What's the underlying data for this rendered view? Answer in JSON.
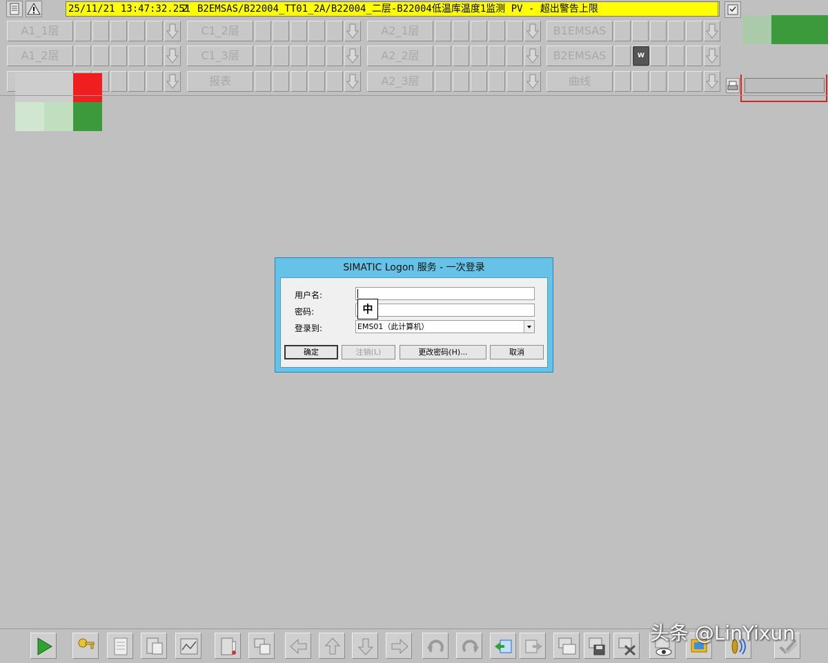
{
  "alarm_bar": {
    "datetime": "25/11/21 13:47:32.251",
    "count": "2",
    "message": "B2EMSAS/B22004_TT01_2A/B22004_二层-B22004低温库温度1监测 PV - 超出警告上限",
    "state": "C"
  },
  "nav": {
    "row1": [
      "A1_1层",
      "C1_2层",
      "A2_1层",
      "B1EMSAS"
    ],
    "row2": [
      "A1_2层",
      "C1_3层",
      "A2_2层",
      "B2EMSAS"
    ],
    "row3": [
      "",
      "报表",
      "A2_3层",
      "曲线"
    ],
    "w_badge": "W"
  },
  "colors": {
    "alarm_yellow": "#ffff00",
    "status_red": "#f01e1e",
    "status_green": "#3c9a3c",
    "dialog_frame": "#65c3e8"
  },
  "dialog": {
    "title": "SIMATIC Logon 服务 - 一次登录",
    "username_label": "用户名:",
    "password_label": "密码:",
    "logon_to_label": "登录到:",
    "username_value": "",
    "password_value": "",
    "logon_to_value": "EMS01（此计算机）",
    "ime_indicator": "中",
    "ok_button": "确定",
    "logoff_button": "注销(L)",
    "change_password_button": "更改密码(H)...",
    "cancel_button": "取消"
  },
  "toolbar_icons": [
    "play-icon",
    "key-icon",
    "alarm-list-icon",
    "report-icon",
    "trend-icon",
    "thermometer-icon",
    "screen-swap-icon",
    "arrow-left-icon",
    "arrow-up-icon",
    "arrow-down-icon",
    "arrow-right-icon",
    "undo-icon",
    "redo-icon",
    "screen-select-icon",
    "screen-forward-icon",
    "window-stack-icon",
    "window-save-icon",
    "window-close-icon",
    "eye-icon",
    "display-icon",
    "horn-icon",
    "check-icon"
  ],
  "watermark": "头条 @LinYixun"
}
